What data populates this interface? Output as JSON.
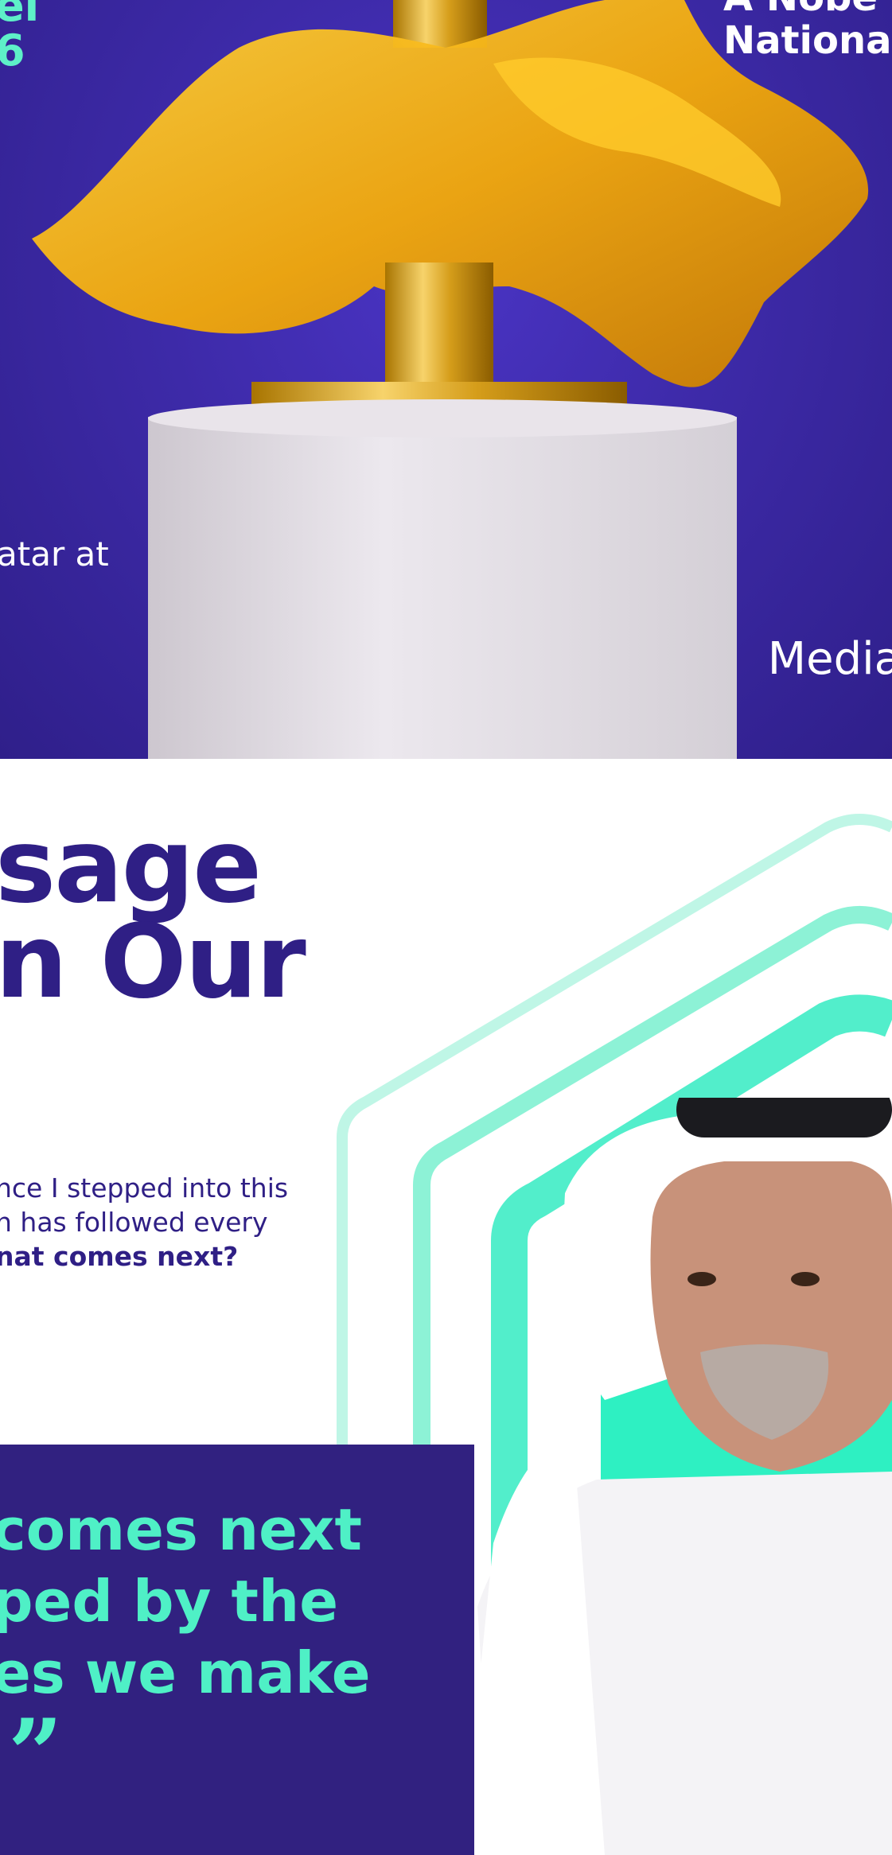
{
  "hero": {
    "left_top_lines": [
      "el",
      "6"
    ],
    "left_mid_text": "atar at",
    "right_top_lines": [
      "A Nobe",
      "National"
    ],
    "right_bottom_text": "Media"
  },
  "message": {
    "headline": "sage\nn Our",
    "intro_lines": [
      "nce I stepped into this",
      "n has followed every"
    ],
    "intro_bold": "nat comes next?"
  },
  "quote": {
    "text": "comes next\nped by the\nes we make",
    "mark": "”"
  },
  "colors": {
    "hero_bg": "#3d2aa8",
    "headline": "#2f1f85",
    "accent_mint": "#4ff0c6",
    "quote_bg": "#312180",
    "gold": "#f5b400"
  }
}
